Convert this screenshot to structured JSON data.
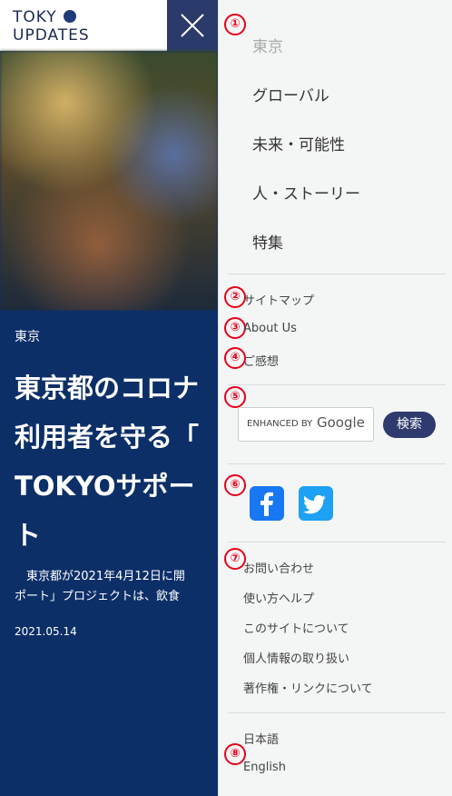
{
  "logo": {
    "line1": "TOKY",
    "line2": "UPDATES"
  },
  "article": {
    "category": "東京",
    "headline": "東京都のコロナ\n利用者を守る「\nTOKYOサポー\nト",
    "excerpt": "　東京都が2021年4月12日に開\nポート」プロジェクトは、飲食",
    "date": "2021.05.14"
  },
  "menu": {
    "categories": [
      "東京",
      "グローバル",
      "未来・可能性",
      "人・ストーリー",
      "特集"
    ],
    "links1": [
      "サイトマップ",
      "About Us",
      "ご感想"
    ],
    "search": {
      "enhanced": "ENHANCED BY",
      "google": "Google",
      "button": "検索"
    },
    "links2": [
      "お問い合わせ",
      "使い方ヘルプ",
      "このサイトについて",
      "個人情報の取り扱い",
      "著作権・リンクについて"
    ],
    "languages": [
      "日本語",
      "English"
    ]
  },
  "annotations": [
    "①",
    "②",
    "③",
    "④",
    "⑤",
    "⑥",
    "⑦",
    "⑧"
  ],
  "colors": {
    "navy": "#0d2f68",
    "annotation_red": "#e6001a",
    "facebook": "#1877f2",
    "twitter": "#1da1f2"
  }
}
